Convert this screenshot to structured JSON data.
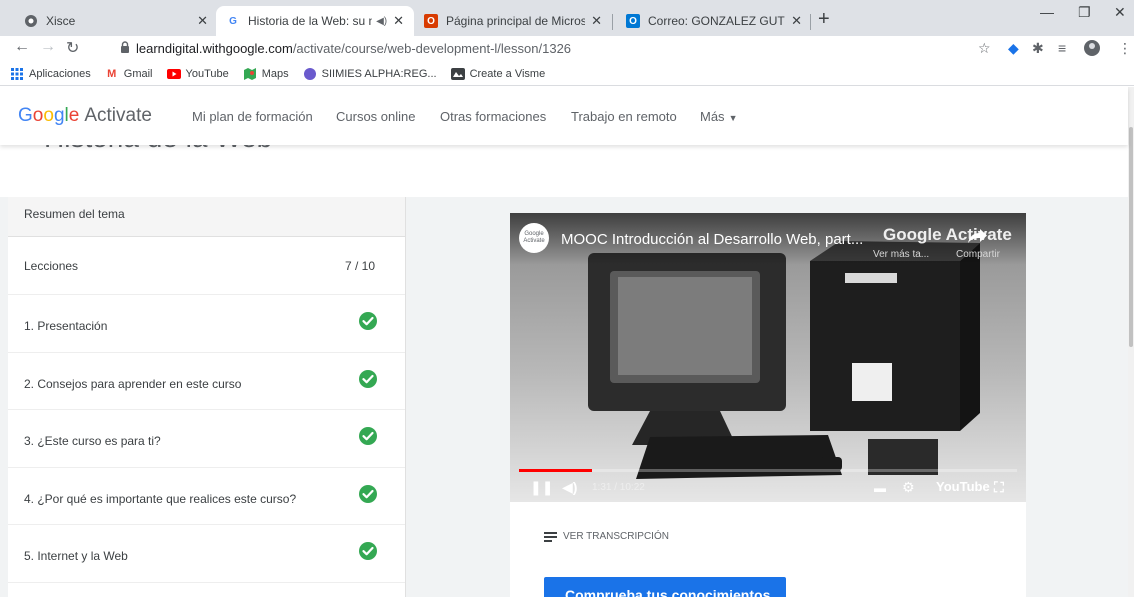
{
  "tabs": [
    {
      "title": "Xisce",
      "icon": "globe-icon"
    },
    {
      "title": "Historia de la Web: su nacim",
      "icon": "google-g-icon",
      "active": true
    },
    {
      "title": "Página principal de Microsoft Of",
      "icon": "office-icon"
    },
    {
      "title": "Correo: GONZALEZ GUTIERREZ A",
      "icon": "outlook-icon"
    }
  ],
  "toolbar": {
    "url_host": "learndigital.withgoogle.com",
    "url_path": "/activate/course/web-development-l/lesson/1326"
  },
  "bookmarks": [
    {
      "label": "Aplicaciones",
      "icon": "apps-grid-icon",
      "color": "#1a73e8"
    },
    {
      "label": "Gmail",
      "icon": "gmail-icon",
      "color": "#ea4335"
    },
    {
      "label": "YouTube",
      "icon": "youtube-icon",
      "color": "#ff0000"
    },
    {
      "label": "Maps",
      "icon": "maps-icon",
      "color": "#34a853"
    },
    {
      "label": "SIIMIES ALPHA:REG...",
      "icon": "circle-icon",
      "color": "#6a5acd"
    },
    {
      "label": "Create a Visme",
      "icon": "visme-icon",
      "color": "#3c4043"
    }
  ],
  "site": {
    "logo_google": [
      "G",
      "o",
      "o",
      "g",
      "l",
      "e"
    ],
    "logo_suffix": "Activate",
    "nav": [
      "Mi plan de formación",
      "Cursos online",
      "Otras formaciones",
      "Trabajo en remoto",
      "Más"
    ],
    "page_title": "Historia de la Web"
  },
  "sidebar": {
    "summary": "Resumen del tema",
    "lessons_label": "Lecciones",
    "lessons_count": "7 / 10",
    "lessons": [
      {
        "title": "1. Presentación",
        "completed": true
      },
      {
        "title": "2. Consejos para aprender en este curso",
        "completed": true
      },
      {
        "title": "3. ¿Este curso es para ti?",
        "completed": true
      },
      {
        "title": "4. ¿Por qué es importante que realices este curso?",
        "completed": true
      },
      {
        "title": "5. Internet y la Web",
        "completed": true
      }
    ]
  },
  "video": {
    "channel": "Google Activate",
    "title": "MOOC Introducción al Desarrollo Web, part...",
    "brand": "Google Activate",
    "watch_more": "Ver más ta...",
    "share": "Compartir",
    "time": "1:31 / 10:22",
    "progress": 0.146,
    "youtube_label": "YouTube"
  },
  "transcript_label": "VER TRANSCRIPCIÓN",
  "check_button": "Comprueba tus conocimientos",
  "colors": {
    "accent": "#1a73e8",
    "check_green": "#34a853",
    "progress_red": "#ff0000"
  }
}
